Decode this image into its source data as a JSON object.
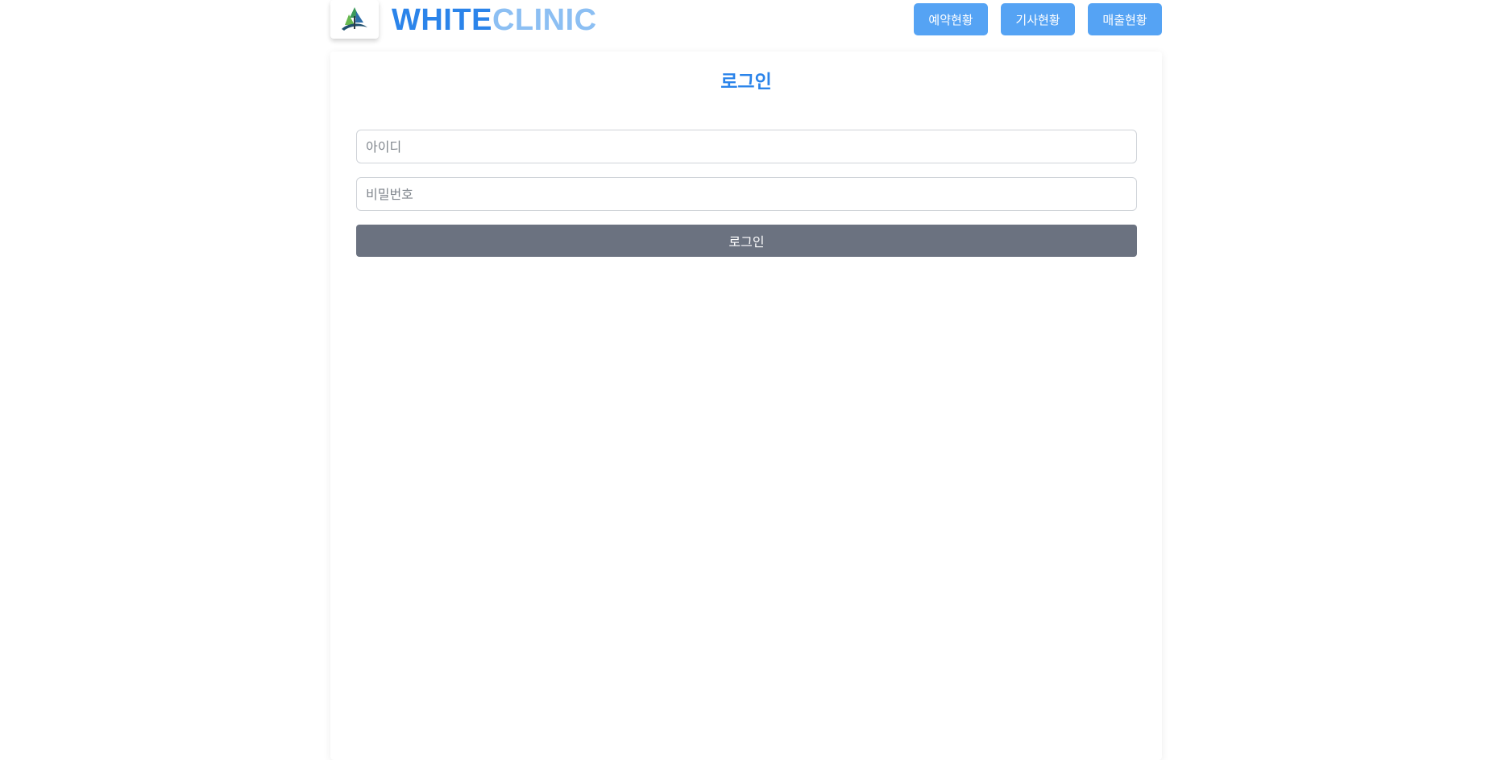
{
  "header": {
    "brand_part1": "WHITE",
    "brand_part2": "CLINIC",
    "logo_icon": "clinic-logo-icon",
    "nav": [
      {
        "label": "예약현황"
      },
      {
        "label": "기사현황"
      },
      {
        "label": "매출현황"
      }
    ]
  },
  "login": {
    "title": "로그인",
    "id_placeholder": "아이디",
    "id_value": "",
    "password_placeholder": "비밀번호",
    "password_value": "",
    "submit_label": "로그인"
  },
  "colors": {
    "accent": "#2b84ea",
    "accent_light": "#8cbff3",
    "nav_button": "#55a3f4",
    "submit_button": "#6b7280"
  }
}
